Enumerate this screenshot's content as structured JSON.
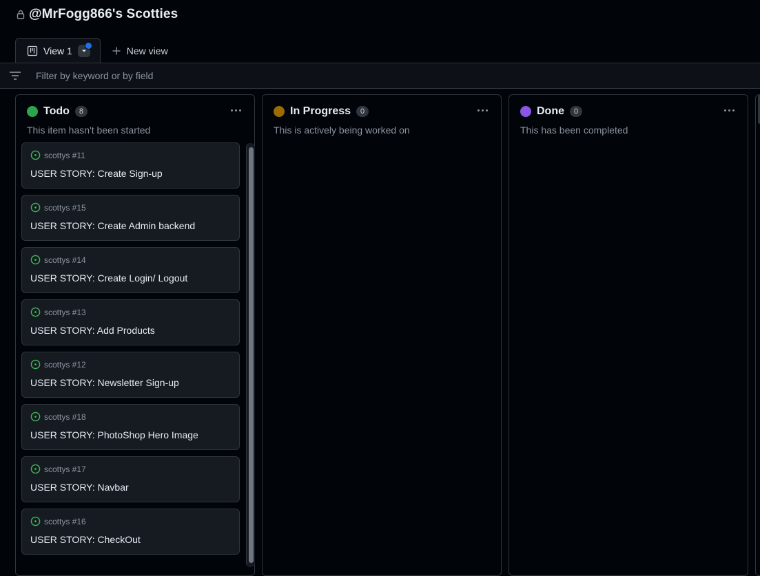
{
  "project": {
    "title": "@MrFogg866's Scotties"
  },
  "tabs": {
    "active_label": "View 1",
    "new_view_label": "New view"
  },
  "filter": {
    "placeholder": "Filter by keyword or by field"
  },
  "colors": {
    "todo": "#2da44e",
    "in_progress": "#9e6a03",
    "done": "#8957e5",
    "issue_open": "#3fb950",
    "accent_blue": "#1f6feb"
  },
  "columns": [
    {
      "name": "Todo",
      "count": "8",
      "description": "This item hasn't been started",
      "status_color": "#2da44e",
      "cards": [
        {
          "repo": "scottys #11",
          "title": "USER STORY: Create Sign-up"
        },
        {
          "repo": "scottys #15",
          "title": "USER STORY: Create Admin backend"
        },
        {
          "repo": "scottys #14",
          "title": "USER STORY: Create Login/ Logout"
        },
        {
          "repo": "scottys #13",
          "title": "USER STORY: Add Products"
        },
        {
          "repo": "scottys #12",
          "title": "USER STORY: Newsletter Sign-up"
        },
        {
          "repo": "scottys #18",
          "title": "USER STORY: PhotoShop Hero Image"
        },
        {
          "repo": "scottys #17",
          "title": "USER STORY: Navbar"
        },
        {
          "repo": "scottys #16",
          "title": "USER STORY: CheckOut"
        }
      ]
    },
    {
      "name": "In Progress",
      "count": "0",
      "description": "This is actively being worked on",
      "status_color": "#9e6a03",
      "cards": []
    },
    {
      "name": "Done",
      "count": "0",
      "description": "This has been completed",
      "status_color": "#8957e5",
      "cards": []
    }
  ]
}
